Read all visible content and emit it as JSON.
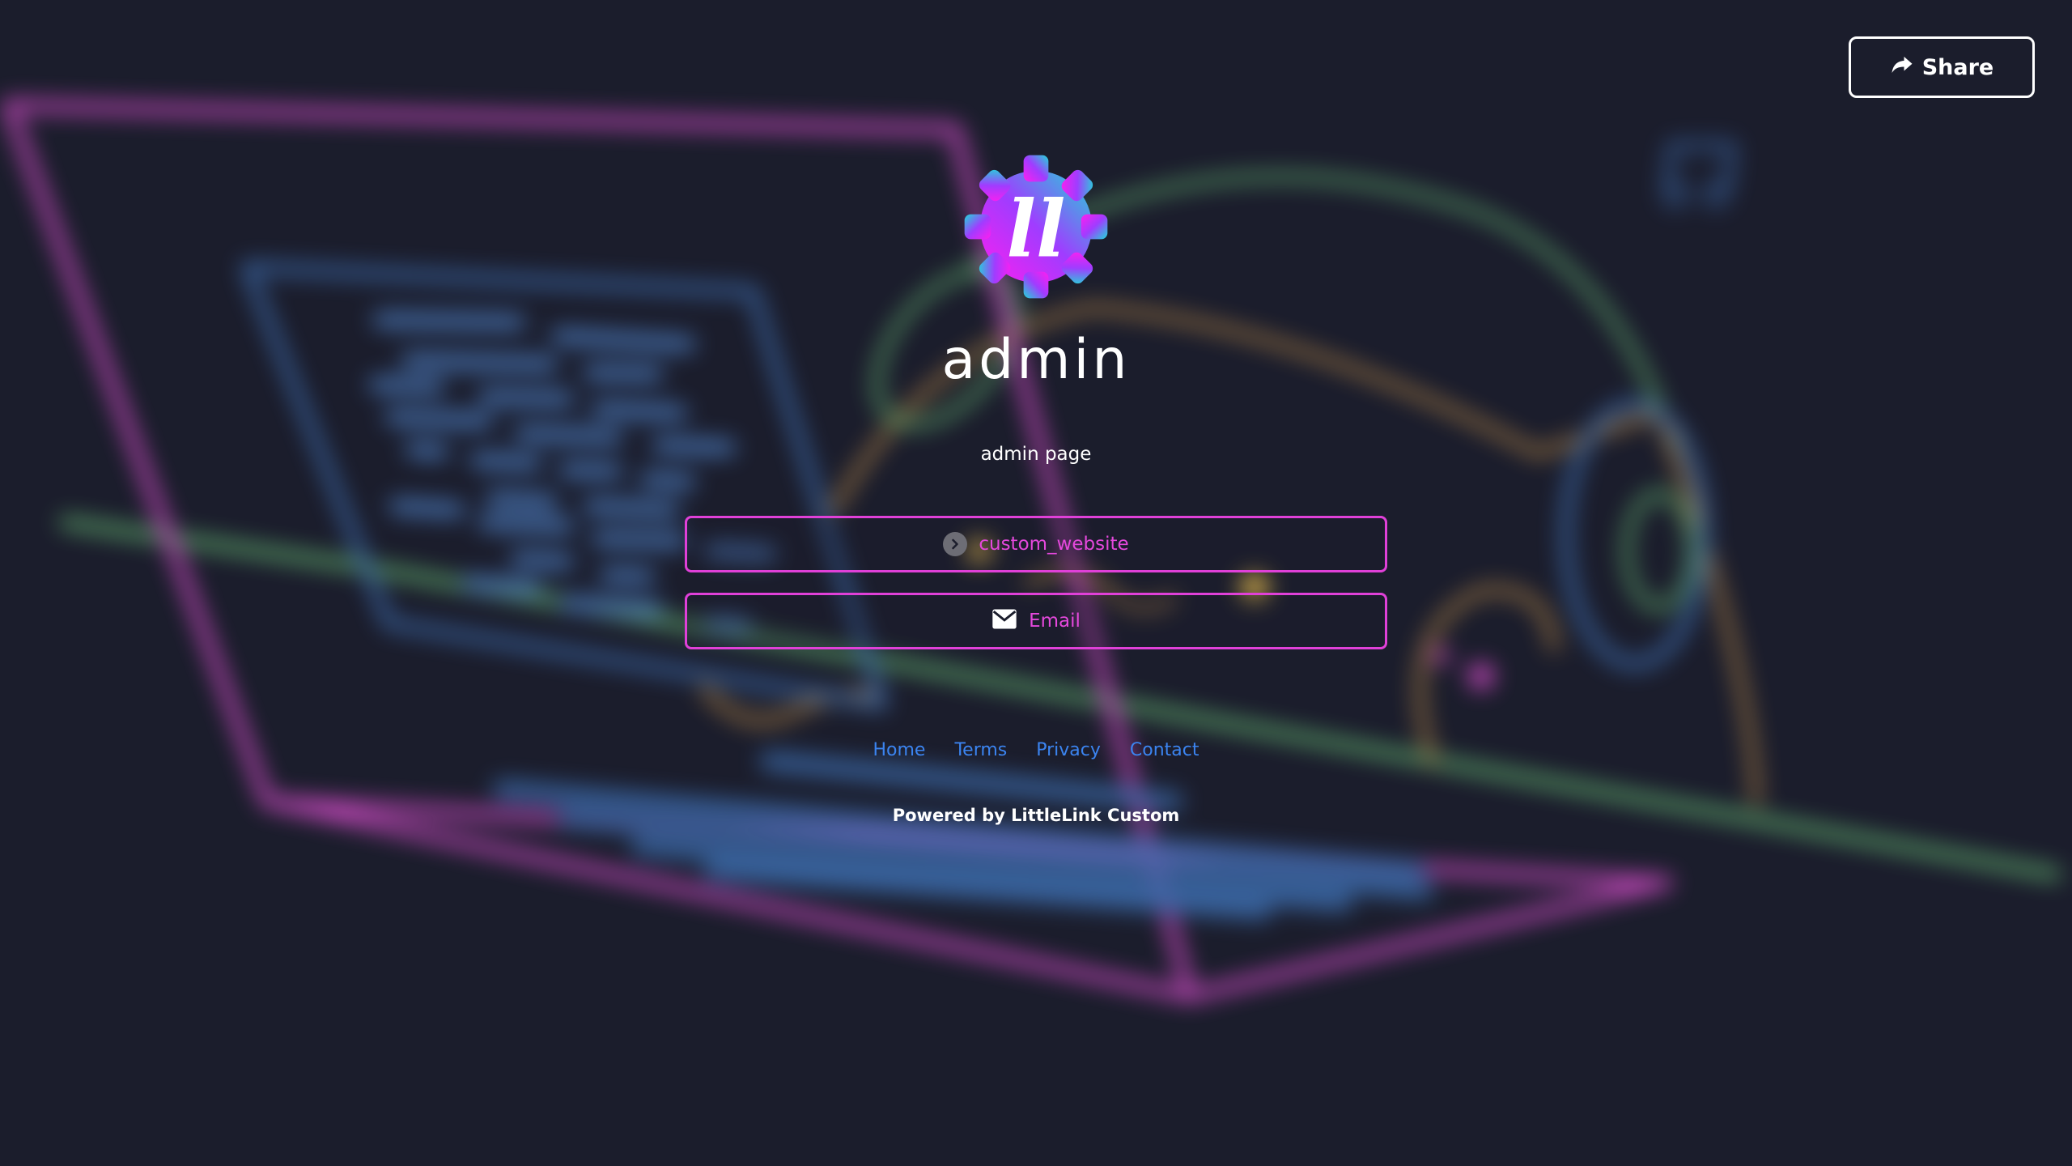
{
  "share": {
    "label": "Share",
    "icon": "share-arrow-icon"
  },
  "profile": {
    "logo_icon": "littlelink-gear-logo",
    "logo_text": "ll",
    "name": "admin",
    "description": "admin page"
  },
  "links": [
    {
      "label": "custom_website",
      "icon": "chevron-right-circle-icon"
    },
    {
      "label": "Email",
      "icon": "envelope-icon"
    }
  ],
  "footer": {
    "links": [
      "Home",
      "Terms",
      "Privacy",
      "Contact"
    ],
    "powered_by": "Powered by LittleLink Custom"
  },
  "colors": {
    "background": "#1b1d2c",
    "button_border": "#e040d8",
    "footer_link": "#3b84f0",
    "text": "#ffffff"
  }
}
